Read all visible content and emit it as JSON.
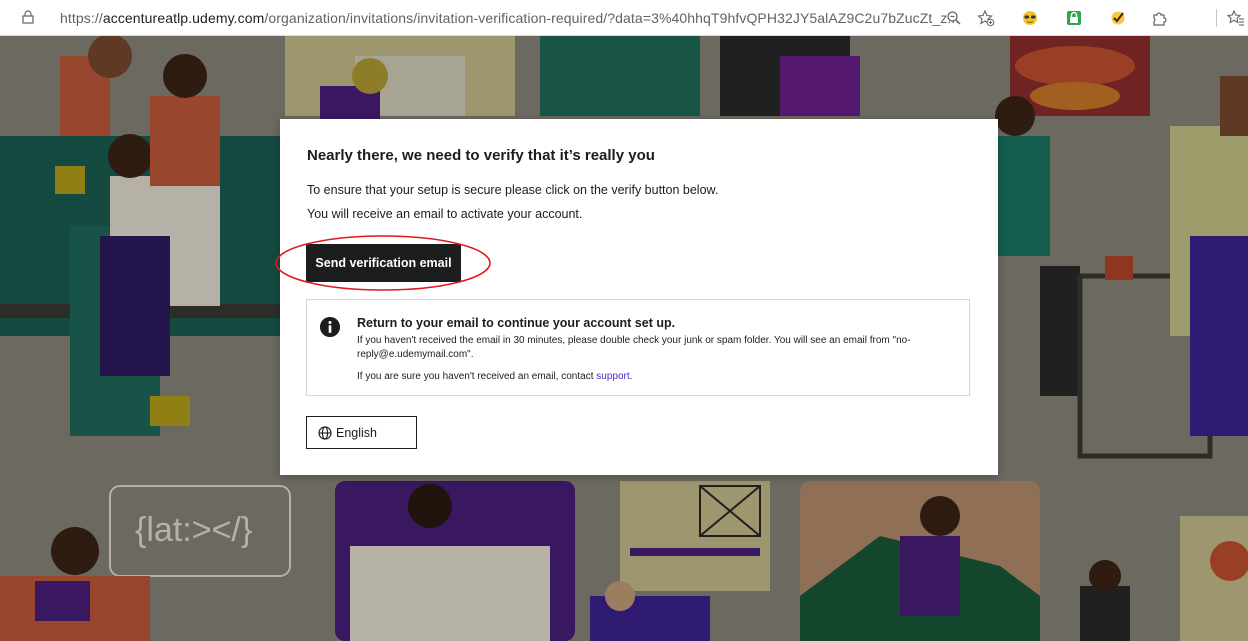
{
  "browser": {
    "url_prefix": "https://",
    "url_host": "accentureatlp.udemy.com",
    "url_path": "/organization/invitations/invitation-verification-required/?data=3%40hhqT9hfvQPH32JY5alAZ9C2u7bZucZt_z...",
    "icons": [
      "lock-icon",
      "zoom-icon",
      "favorite-add-icon",
      "sunglasses-extension-icon",
      "password-extension-icon",
      "checkmark-extension-icon",
      "puzzle-extension-icon",
      "favorites-icon"
    ]
  },
  "background": {
    "sign_text": "{lat:></}"
  },
  "modal": {
    "title": "Nearly there, we need to verify that it’s really you",
    "description_line1": "To ensure that your setup is secure please click on the verify button below.",
    "description_line2": "You will receive an email to activate your account.",
    "send_button_label": "Send verification email",
    "info": {
      "title": "Return to your email to continue your account set up.",
      "text": "If you haven't received the email in 30 minutes, please double check your junk or spam folder. You will see an email from \"no-reply@e.udemymail.com\".",
      "support_prefix": "If you are sure you haven't received an email, contact ",
      "support_link": "support",
      "support_suffix": "."
    },
    "language_label": "English"
  },
  "colors": {
    "button_bg": "#1c1d1f",
    "link": "#5624d0",
    "highlight_ring": "#e0191c"
  }
}
